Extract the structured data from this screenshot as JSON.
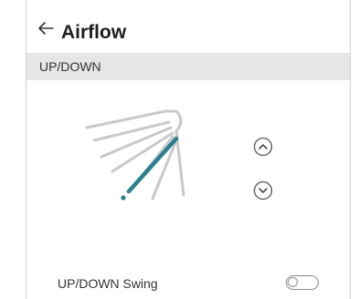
{
  "header": {
    "title": "Airflow",
    "back_icon": "arrow-left-icon"
  },
  "section": {
    "label": "UP/DOWN"
  },
  "controls": {
    "up_icon": "chevron-up-icon",
    "down_icon": "chevron-down-icon",
    "vane_icon": "airflow-vane-icon",
    "accent_color": "#2b7f8f",
    "fan_color": "#c9c9c9"
  },
  "swing": {
    "label": "UP/DOWN Swing",
    "toggle_state": "off"
  }
}
